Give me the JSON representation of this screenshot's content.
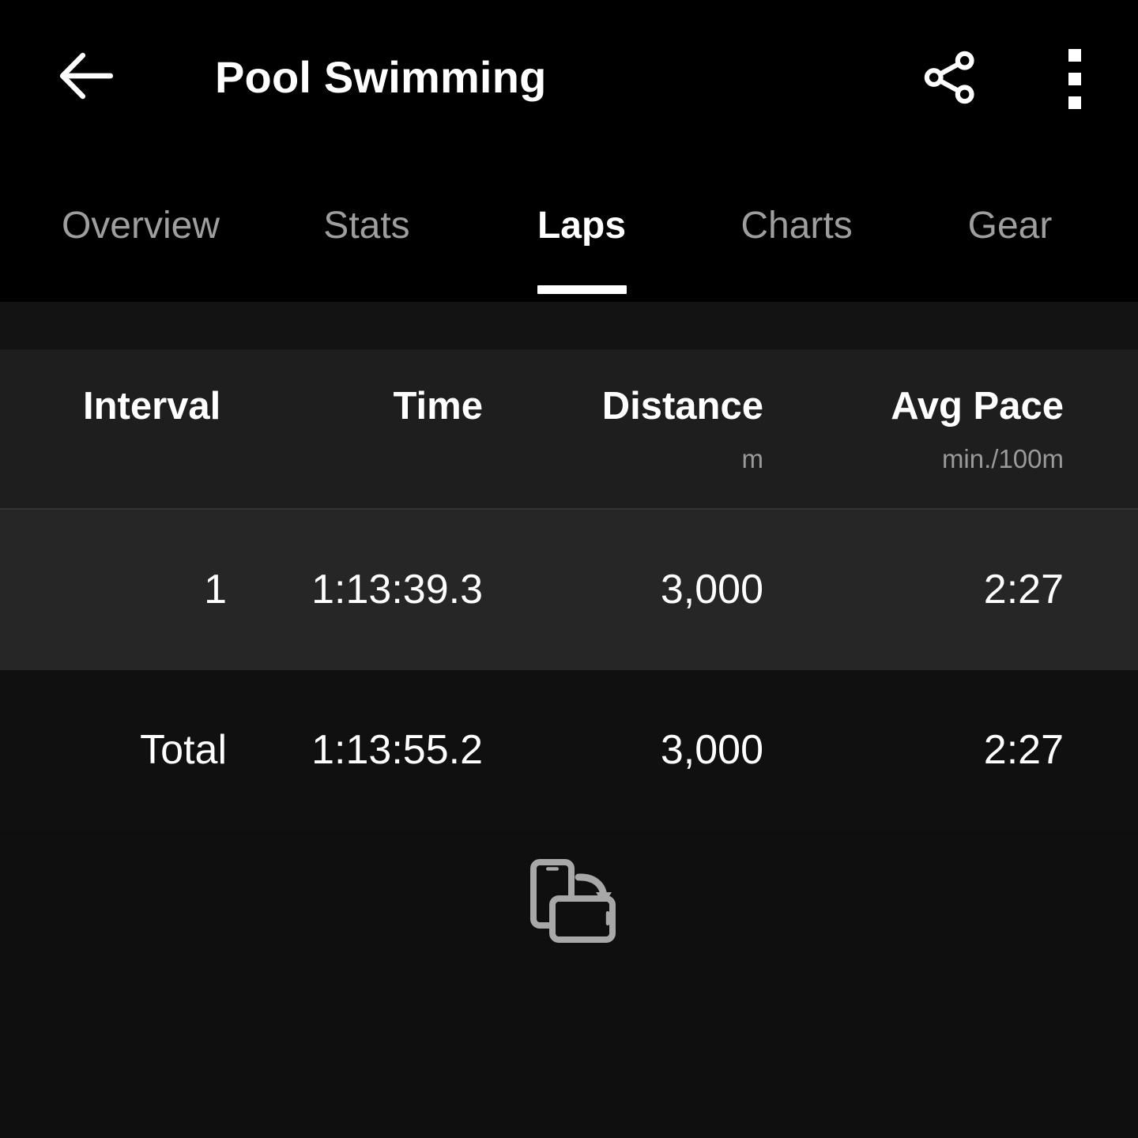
{
  "appbar": {
    "title": "Pool Swimming",
    "back_icon": "arrow-left-icon",
    "share_icon": "share-icon",
    "overflow_icon": "more-vertical-icon"
  },
  "tabs": {
    "active_index": 2,
    "items": [
      {
        "label": "Overview"
      },
      {
        "label": "Stats"
      },
      {
        "label": "Laps"
      },
      {
        "label": "Charts"
      },
      {
        "label": "Gear"
      }
    ]
  },
  "table": {
    "columns": [
      {
        "label": "Interval",
        "unit": ""
      },
      {
        "label": "Time",
        "unit": ""
      },
      {
        "label": "Distance",
        "unit": "m"
      },
      {
        "label": "Avg Pace",
        "unit": "min./100m"
      }
    ],
    "rows": [
      {
        "interval": "1",
        "time": "1:13:39.3",
        "distance": "3,000",
        "pace": "2:27"
      }
    ],
    "total": {
      "interval": "Total",
      "time": "1:13:55.2",
      "distance": "3,000",
      "pace": "2:27"
    }
  },
  "hint": {
    "icon": "rotate-device-icon"
  },
  "colors": {
    "background": "#0f0f0f",
    "appbar": "#000000",
    "header_row": "#1e1e1e",
    "lap_row": "#262626",
    "total_row": "#101010",
    "text_primary": "#ffffff",
    "text_secondary": "#9e9e9e",
    "accent": "#ffffff"
  }
}
